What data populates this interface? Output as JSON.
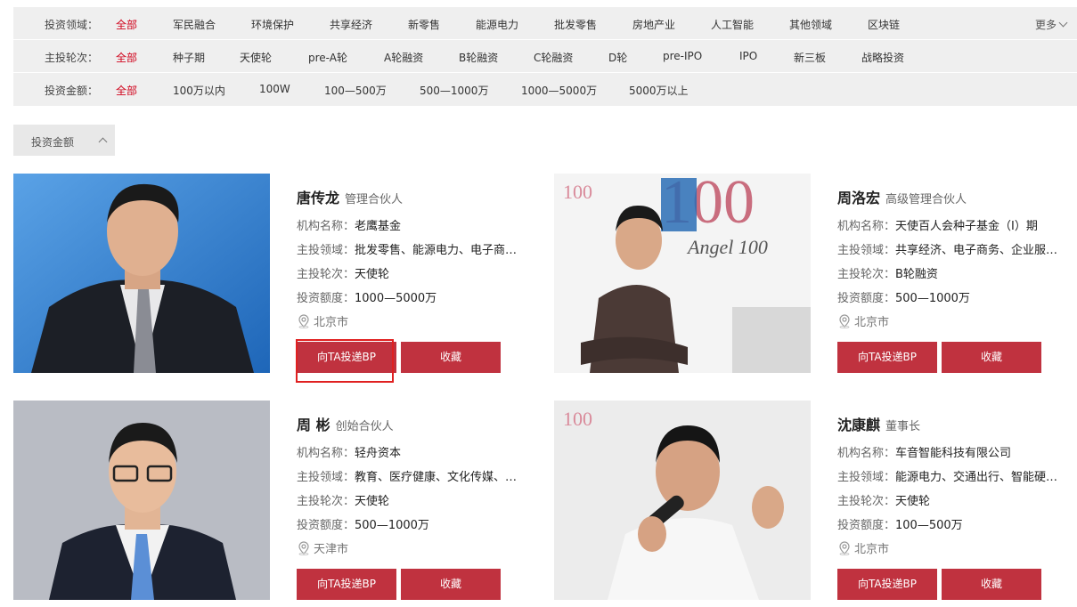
{
  "filters": [
    {
      "label": "投资领域：",
      "options": [
        "全部",
        "军民融合",
        "环境保护",
        "共享经济",
        "新零售",
        "能源电力",
        "批发零售",
        "房地产业",
        "人工智能",
        "其他领域",
        "区块链"
      ],
      "active": 0,
      "more": "更多"
    },
    {
      "label": "主投轮次：",
      "options": [
        "全部",
        "种子期",
        "天使轮",
        "pre-A轮",
        "A轮融资",
        "B轮融资",
        "C轮融资",
        "D轮",
        "pre-IPO",
        "IPO",
        "新三板",
        "战略投资"
      ],
      "active": 0
    },
    {
      "label": "投资金额：",
      "options": [
        "全部",
        "100万以内",
        "100W",
        "100—500万",
        "500—1000万",
        "1000—5000万",
        "5000万以上"
      ],
      "active": 0
    }
  ],
  "sort": {
    "label": "投资金额"
  },
  "field_labels": {
    "org": "机构名称：",
    "domain": "主投领域：",
    "round": "主投轮次：",
    "amount": "投资额度："
  },
  "buttons": {
    "bp": "向TA投递BP",
    "fav": "收藏"
  },
  "investors": [
    {
      "name": "唐传龙",
      "title": "管理合伙人",
      "org": "老鹰基金",
      "domain": "批发零售、能源电力、电子商…",
      "round": "天使轮",
      "amount": "1000—5000万",
      "city": "北京市",
      "photo": "portrait-suit-dark"
    },
    {
      "name": "周洛宏",
      "title": "高级管理合伙人",
      "org": "天使百人会种子基金（Ⅰ）期",
      "domain": "共享经济、电子商务、企业服…",
      "round": "B轮融资",
      "amount": "500—1000万",
      "city": "北京市",
      "photo": "portrait-angel100"
    },
    {
      "name": "周 彬",
      "title": "创始合伙人",
      "org": "轻舟资本",
      "domain": "教育、医疗健康、文化传媒、…",
      "round": "天使轮",
      "amount": "500—1000万",
      "city": "天津市",
      "photo": "portrait-glasses"
    },
    {
      "name": "沈康麒",
      "title": "董事长",
      "org": "车音智能科技有限公司",
      "domain": "能源电力、交通出行、智能硬…",
      "round": "天使轮",
      "amount": "100—500万",
      "city": "北京市",
      "photo": "portrait-microphone"
    }
  ],
  "colors": {
    "accent": "#d0021b",
    "button": "#c0323f",
    "filter_bg": "#efefef"
  }
}
